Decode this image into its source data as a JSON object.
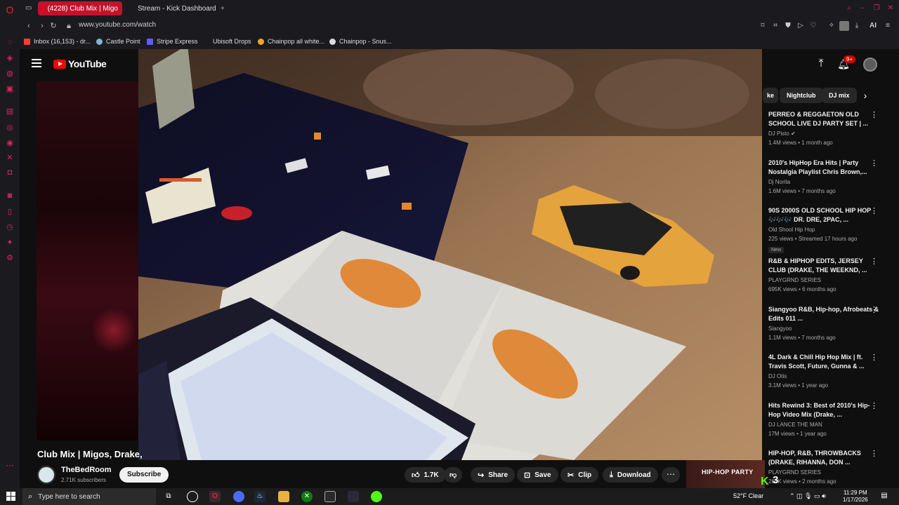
{
  "browser": {
    "tabs": [
      {
        "label": "(4228) Club Mix | Migo",
        "active": true
      },
      {
        "label": "Stream - Kick Dashboard",
        "active": false
      }
    ],
    "new_tab_label": "+",
    "url": "www.youtube.com/watch",
    "ai_label": "AI",
    "bookmarks": [
      "Inbox (16,153) - dr...",
      "Castle Point",
      "Stripe Express",
      "Ubisoft Drops",
      "Chainpop all white...",
      "Chainpop - Snus..."
    ]
  },
  "youtube": {
    "logo_text": "YouTube",
    "notification_count": "9+",
    "chips": [
      "ke",
      "Nightclub",
      "DJ mix"
    ],
    "recommendations": [
      {
        "title": "PERREO & REGGAETON OLD SCHOOL LIVE DJ PARTY SET | ...",
        "channel": "DJ Pisto",
        "verified": true,
        "meta": "1.4M views • 1 month ago"
      },
      {
        "title": "2010's HipHop Era Hits | Party Nostalgia Playlist Chris Brown,...",
        "channel": "Dj Norita",
        "meta": "1.6M views • 7 months ago"
      },
      {
        "title": "90S 2000S OLD SCHOOL HIP HOP 🎶🎶🎶 DR. DRE, 2PAC, ...",
        "channel": "Old Shool Hip Hop",
        "meta": "225 views • Streamed 17 hours ago",
        "badge": "New"
      },
      {
        "title": "R&B & HIPHOP EDITS, JERSEY CLUB (DRAKE, THE WEEKND, ...",
        "channel": "PLAYGRND SERIES",
        "meta": "695K views • 6 months ago"
      },
      {
        "title": "Siangyoo R&B, Hip-hop, Afrobeats & Edits 011 ...",
        "channel": "Siangyoo",
        "meta": "1.1M views • 7 months ago"
      },
      {
        "title": "4L Dark & Chill Hip Hop Mix | ft. Travis Scott, Future, Gunna & ...",
        "channel": "DJ Otis",
        "meta": "3.1M views • 1 year ago"
      },
      {
        "title": "Hits Rewind 3: Best of 2010's Hip-Hop Video Mix (Drake, ...",
        "channel": "DJ LANCE THE MAN",
        "meta": "17M views • 1 year ago"
      },
      {
        "title": "HIP-HOP, R&B, THROWBACKS (DRAKE, RIHANNA, DON ...",
        "channel": "PLAYGRND SERIES",
        "meta": "266K views • 2 months ago"
      }
    ],
    "video": {
      "title": "Club Mix | Migos, Drake,",
      "channel": "TheBedRoom",
      "subscribers": "2.71K subscribers",
      "subscribe_label": "Subscribe",
      "likes": "1.7K",
      "share_label": "Share",
      "save_label": "Save",
      "clip_label": "Clip",
      "download_label": "Download",
      "ad_text": "HIP-HOP PARTY",
      "overlay_number": "3"
    }
  },
  "taskbar": {
    "search_placeholder": "Type here to search",
    "weather": "52°F  Clear",
    "time": "11:29 PM",
    "date": "1/17/2026"
  },
  "colors": {
    "accent": "#c4122b",
    "youtube_red": "#ff0000",
    "kick_green": "#53fc18"
  }
}
